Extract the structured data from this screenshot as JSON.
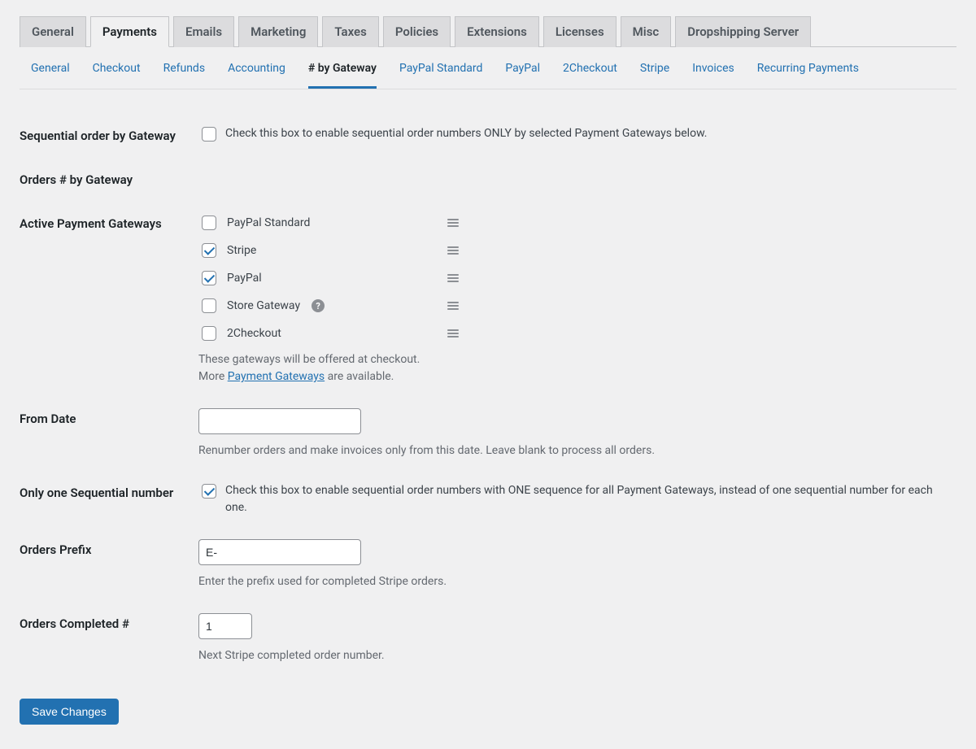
{
  "tabs": {
    "primary": [
      {
        "label": "General",
        "active": false
      },
      {
        "label": "Payments",
        "active": true
      },
      {
        "label": "Emails",
        "active": false
      },
      {
        "label": "Marketing",
        "active": false
      },
      {
        "label": "Taxes",
        "active": false
      },
      {
        "label": "Policies",
        "active": false
      },
      {
        "label": "Extensions",
        "active": false
      },
      {
        "label": "Licenses",
        "active": false
      },
      {
        "label": "Misc",
        "active": false
      },
      {
        "label": "Dropshipping Server",
        "active": false
      }
    ],
    "secondary": [
      {
        "label": "General",
        "active": false
      },
      {
        "label": "Checkout",
        "active": false
      },
      {
        "label": "Refunds",
        "active": false
      },
      {
        "label": "Accounting",
        "active": false
      },
      {
        "label": "# by Gateway",
        "active": true
      },
      {
        "label": "PayPal Standard",
        "active": false
      },
      {
        "label": "PayPal",
        "active": false
      },
      {
        "label": "2Checkout",
        "active": false
      },
      {
        "label": "Stripe",
        "active": false
      },
      {
        "label": "Invoices",
        "active": false
      },
      {
        "label": "Recurring Payments",
        "active": false
      }
    ]
  },
  "fields": {
    "seq_by_gateway": {
      "label": "Sequential order by Gateway",
      "checkbox_label": "Check this box to enable sequential order numbers ONLY by selected Payment Gateways below.",
      "checked": false
    },
    "section_heading": "Orders # by Gateway",
    "active_gateways": {
      "label": "Active Payment Gateways",
      "items": [
        {
          "label": "PayPal Standard",
          "checked": false,
          "help": false
        },
        {
          "label": "Stripe",
          "checked": true,
          "help": false
        },
        {
          "label": "PayPal",
          "checked": true,
          "help": false
        },
        {
          "label": "Store Gateway",
          "checked": false,
          "help": true
        },
        {
          "label": "2Checkout",
          "checked": false,
          "help": false
        }
      ],
      "desc_line1": "These gateways will be offered at checkout.",
      "desc_more": "More ",
      "desc_link": "Payment Gateways",
      "desc_after": " are available."
    },
    "from_date": {
      "label": "From Date",
      "value": "",
      "desc": "Renumber orders and make invoices only from this date. Leave blank to process all orders."
    },
    "one_seq": {
      "label": "Only one Sequential number",
      "checkbox_label": "Check this box to enable sequential order numbers with ONE sequence for all Payment Gateways, instead of one sequential number for each one.",
      "checked": true
    },
    "orders_prefix": {
      "label": "Orders Prefix",
      "value": "E-",
      "desc": "Enter the prefix used for completed Stripe orders."
    },
    "orders_completed": {
      "label": "Orders Completed #",
      "value": "1",
      "desc": "Next Stripe completed order number."
    }
  },
  "buttons": {
    "save": "Save Changes"
  },
  "icons": {
    "help_glyph": "?"
  }
}
